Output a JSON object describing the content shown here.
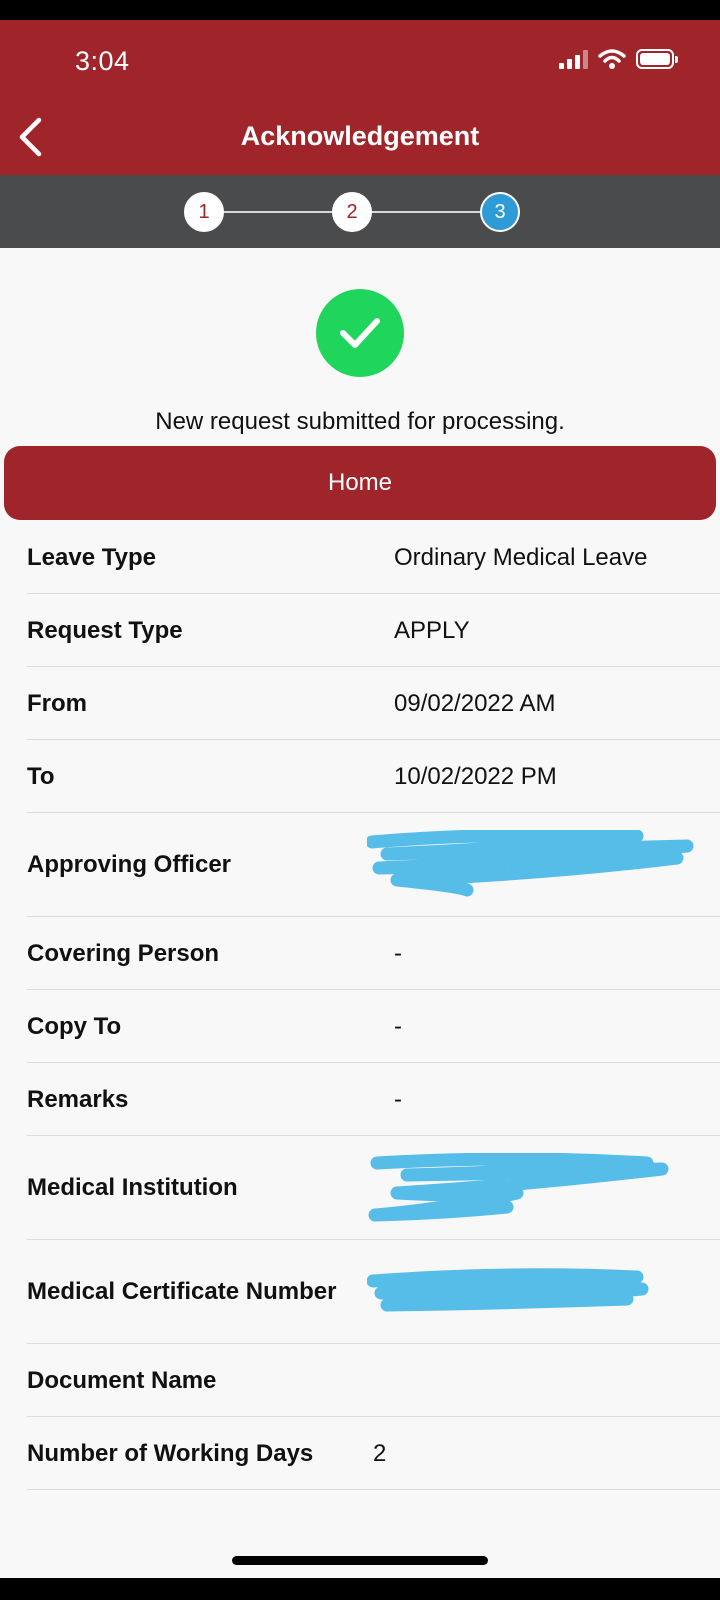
{
  "status_bar": {
    "time": "3:04"
  },
  "header": {
    "title": "Acknowledgement",
    "brand_color": "#a0252b"
  },
  "stepper": {
    "steps": [
      "1",
      "2",
      "3"
    ],
    "current_step": 3
  },
  "confirmation": {
    "icon": "check-icon",
    "message": "New request submitted for processing.",
    "accent": "#1fd55c"
  },
  "home_button": {
    "label": "Home"
  },
  "details": [
    {
      "label": "Leave Type",
      "value": "Ordinary Medical Leave"
    },
    {
      "label": "Request Type",
      "value": "APPLY"
    },
    {
      "label": "From",
      "value": "09/02/2022 AM"
    },
    {
      "label": "To",
      "value": "10/02/2022 PM"
    },
    {
      "label": "Approving Officer",
      "value": ""
    },
    {
      "label": "Covering Person",
      "value": "-"
    },
    {
      "label": "Copy To",
      "value": "-"
    },
    {
      "label": "Remarks",
      "value": "-"
    },
    {
      "label": "Medical Institution",
      "value": ""
    },
    {
      "label": "Medical Certificate Number",
      "value": ""
    },
    {
      "label": "Document Name",
      "value": ""
    },
    {
      "label": "Number of Working Days",
      "value": "2"
    }
  ]
}
